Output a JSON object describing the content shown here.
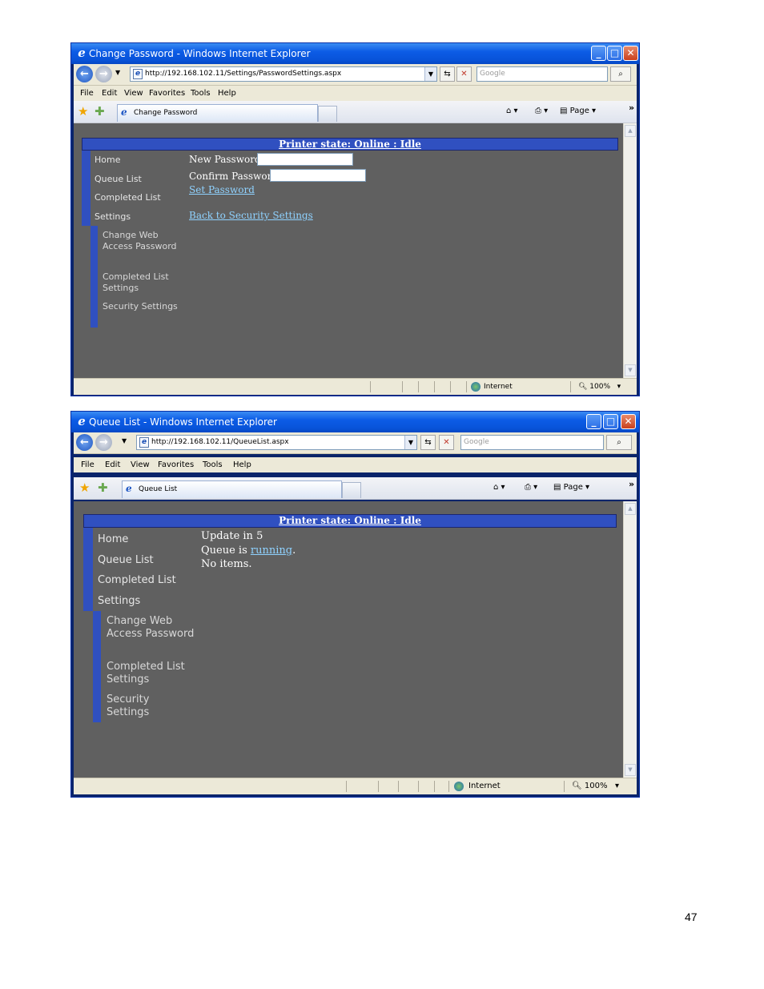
{
  "window1": {
    "title": "Change Password - Windows Internet Explorer",
    "url": "http://192.168.102.11/Settings/PasswordSettings.aspx",
    "search_placeholder": "Google",
    "tab_label": "Change Password",
    "printer_state": "Printer state: Online : Idle",
    "nav": {
      "home": "Home",
      "queue_list": "Queue List",
      "completed_list": "Completed List",
      "settings": "Settings",
      "sub_change_web_access_password": "Change Web Access Password",
      "sub_completed_list_settings": "Completed List Settings",
      "sub_security_settings": "Security Settings"
    },
    "form": {
      "new_password_label": "New Password:",
      "confirm_password_label": "Confirm Password:",
      "set_password_link": "Set Password",
      "back_link": "Back to Security Settings"
    },
    "status": {
      "zone": "Internet",
      "zoom": "100%"
    }
  },
  "window2": {
    "title": "Queue List - Windows Internet Explorer",
    "url": "http://192.168.102.11/QueueList.aspx",
    "search_placeholder": "Google",
    "tab_label": "Queue List",
    "printer_state": "Printer state: Online : Idle",
    "nav": {
      "home": "Home",
      "queue_list": "Queue List",
      "completed_list": "Completed List",
      "settings": "Settings",
      "sub_change_web_access_password": "Change Web Access Password",
      "sub_completed_list_settings": "Completed List Settings",
      "sub_security_settings": "Security Settings"
    },
    "queue": {
      "update_text": "Update in 5",
      "queue_is_prefix": "Queue is ",
      "queue_status_link": "running",
      "queue_is_suffix": ".",
      "no_items": "No items."
    },
    "status": {
      "zone": "Internet",
      "zoom": "100%"
    }
  },
  "menu": {
    "file": "File",
    "edit": "Edit",
    "view": "View",
    "favorites": "Favorites",
    "tools": "Tools",
    "help": "Help"
  },
  "command_bar": {
    "page_label": "Page"
  },
  "page_number": "47",
  "colors": {
    "titlebar": "#0c5ce6",
    "content_bg": "#606060",
    "nav_accent": "#3050c0",
    "link": "#8fd2ff"
  }
}
